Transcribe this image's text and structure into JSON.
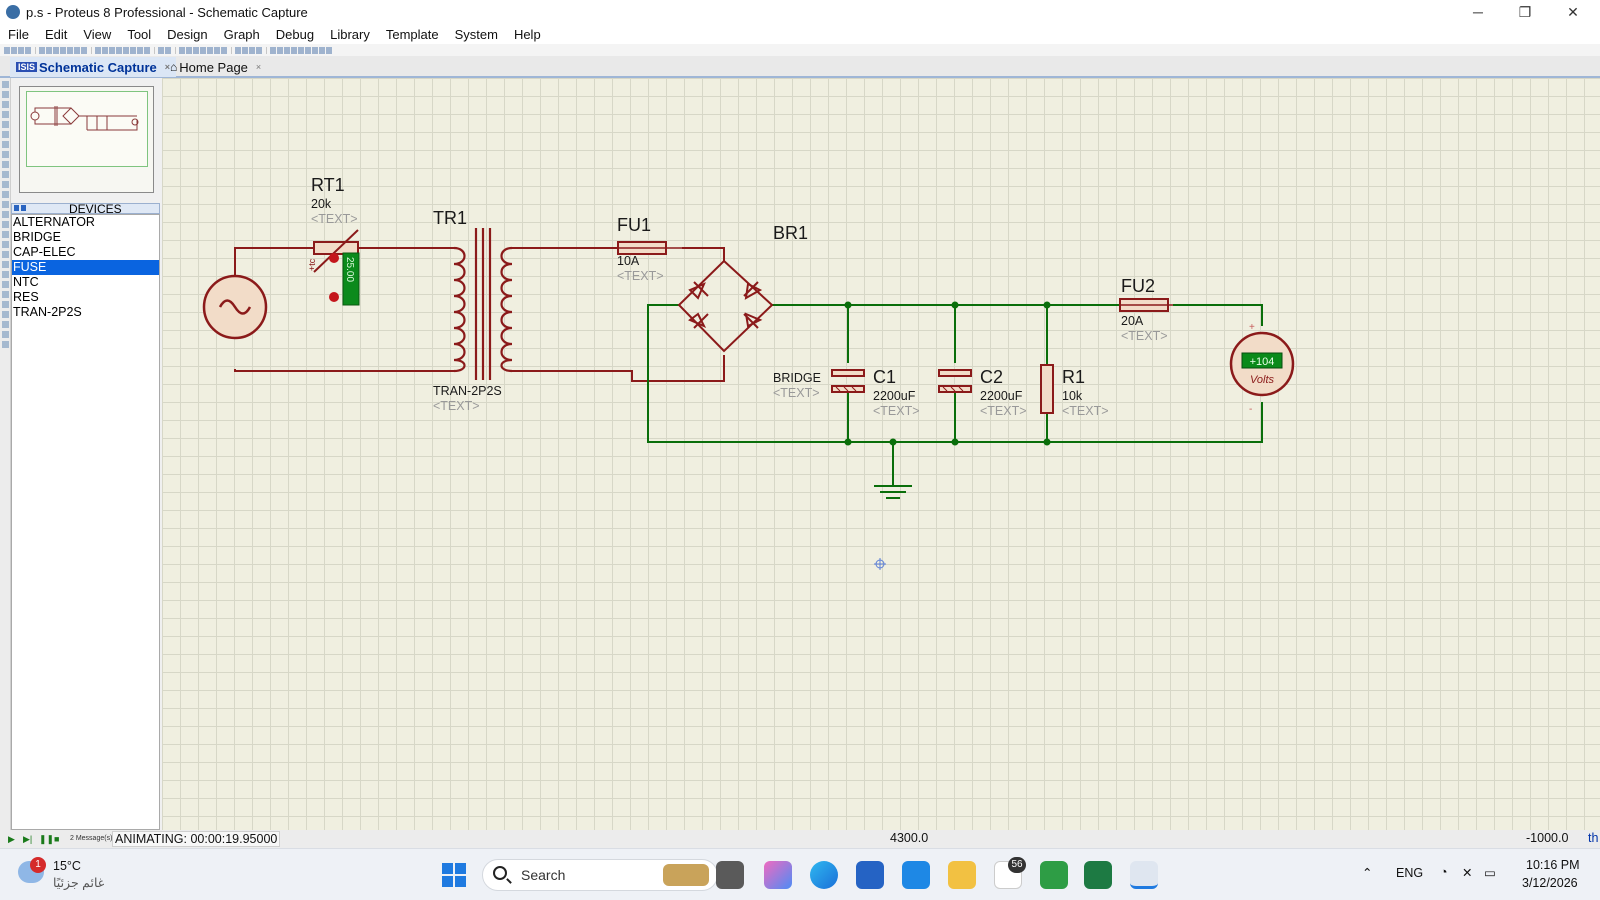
{
  "window": {
    "title": "p.s - Proteus 8 Professional - Schematic Capture",
    "minimize": "─",
    "restore": "❐",
    "close": "✕"
  },
  "menu": [
    "File",
    "Edit",
    "View",
    "Tool",
    "Design",
    "Graph",
    "Debug",
    "Library",
    "Template",
    "System",
    "Help"
  ],
  "tabs": [
    {
      "badge": "ISIS",
      "label": "Schematic Capture",
      "close": "×"
    },
    {
      "label": "Home Page",
      "close": "×"
    }
  ],
  "devices": {
    "header": "DEVICES",
    "items": [
      "ALTERNATOR",
      "BRIDGE",
      "CAP-ELEC",
      "FUSE",
      "NTC",
      "RES",
      "TRAN-2P2S"
    ],
    "selected": "FUSE"
  },
  "schematic": {
    "rt1": {
      "ref": "RT1",
      "value": "20k",
      "text": "<TEXT>",
      "temp": "25.00",
      "temp_unit": "+tc"
    },
    "tr1": {
      "ref": "TR1",
      "part": "TRAN-2P2S",
      "text": "<TEXT>"
    },
    "fu1": {
      "ref": "FU1",
      "value": "10A",
      "text": "<TEXT>"
    },
    "br1": {
      "ref": "BR1",
      "part": "BRIDGE",
      "text": "<TEXT>"
    },
    "c1": {
      "ref": "C1",
      "value": "2200uF",
      "text": "<TEXT>"
    },
    "c2": {
      "ref": "C2",
      "value": "2200uF",
      "text": "<TEXT>"
    },
    "r1": {
      "ref": "R1",
      "value": "10k",
      "text": "<TEXT>"
    },
    "fu2": {
      "ref": "FU2",
      "value": "20A",
      "text": "<TEXT>"
    },
    "voltmeter": {
      "reading": "+104",
      "unit": "Volts",
      "plus": "+",
      "minus": "-"
    }
  },
  "status": {
    "animating": "ANIMATING: 00:00:19.95000",
    "messages": "2 Message(s)",
    "coord_x": "4300.0",
    "coord_y": "-1000.0",
    "units": "th"
  },
  "taskbar": {
    "weather_temp": "15°C",
    "weather_desc": "غائم جزئيًا",
    "weather_badge": "1",
    "search_label": "Search",
    "badge_count": "56",
    "lang": "ENG",
    "time": "10:16 PM",
    "date": "3/12/2026"
  }
}
